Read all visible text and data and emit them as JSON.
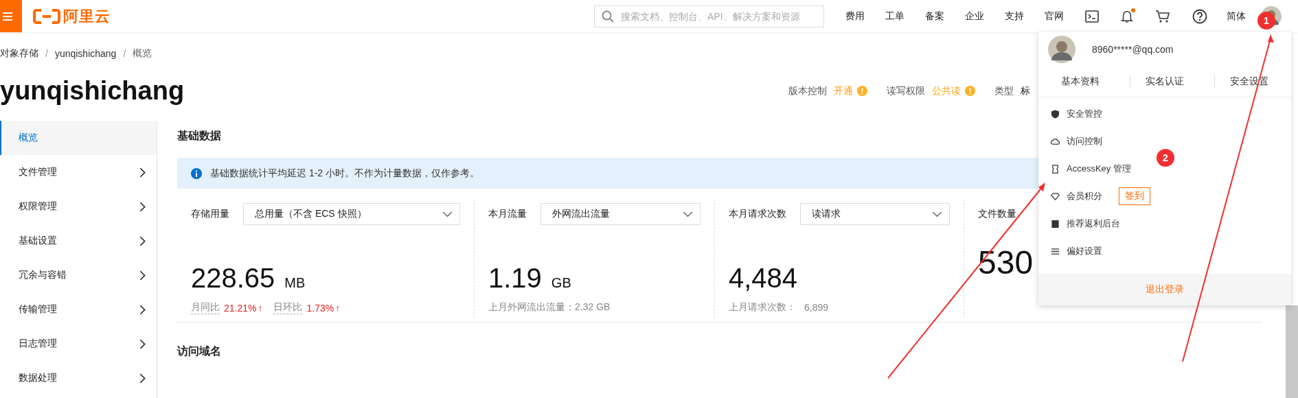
{
  "topbar": {
    "logo": "阿里云",
    "search": {
      "placeholder": "搜索文档、控制台、API、解决方案和资源"
    },
    "nav": [
      "费用",
      "工单",
      "备案",
      "企业",
      "支持",
      "官网"
    ],
    "bell_unread": true,
    "language": "简体"
  },
  "breadcrumb": {
    "separator": "/",
    "items": [
      "对象存储",
      "yunqishichang",
      "概览"
    ]
  },
  "bucket": {
    "title": "yunqishichang",
    "meta": [
      {
        "label": "版本控制",
        "value": "开通",
        "warning": true
      },
      {
        "label": "读写权限",
        "value": "公共读",
        "warning": true
      },
      {
        "label": "类型",
        "value": "标"
      }
    ]
  },
  "sidebar": {
    "items": [
      {
        "label": "概览",
        "selected": true,
        "expandable": false
      },
      {
        "label": "文件管理",
        "selected": false,
        "expandable": true
      },
      {
        "label": "权限管理",
        "selected": false,
        "expandable": true
      },
      {
        "label": "基础设置",
        "selected": false,
        "expandable": true
      },
      {
        "label": "冗余与容错",
        "selected": false,
        "expandable": true
      },
      {
        "label": "传输管理",
        "selected": false,
        "expandable": true
      },
      {
        "label": "日志管理",
        "selected": false,
        "expandable": true
      },
      {
        "label": "数据处理",
        "selected": false,
        "expandable": true
      }
    ]
  },
  "overview": {
    "title": "基础数据",
    "notice": "基础数据统计平均延迟 1-2 小时。不作为计量数据，仅作参考。",
    "stats": [
      {
        "label": "存储用量",
        "select": "总用量（不含 ECS 快照）",
        "value": "228.65",
        "unit": "MB",
        "compare": [
          {
            "label": "月同比",
            "value": "21.21%",
            "arrow": "↑"
          },
          {
            "label": "日环比",
            "value": "1.73%",
            "arrow": "↑"
          }
        ]
      },
      {
        "label": "本月流量",
        "select": "外网流出流量",
        "value": "1.19",
        "unit": "GB",
        "footnote": "上月外网流出流量：2.32 GB"
      },
      {
        "label": "本月请求次数",
        "select": "读请求",
        "value": "4,484",
        "footnote": "上月请求次数：",
        "footnote_value": "6,899"
      },
      {
        "label": "文件数量",
        "value": "530"
      }
    ]
  },
  "domains": {
    "title": "访问域名"
  },
  "account_menu": {
    "email": "8960*****@qq.com",
    "links": [
      "基本资料",
      "实名认证",
      "安全设置"
    ],
    "items": [
      {
        "kind": "plain",
        "label": "安全管控"
      },
      {
        "kind": "plain",
        "label": "访问控制"
      },
      {
        "kind": "plain",
        "label": "AccessKey 管理"
      },
      {
        "kind": "action",
        "label": "会员积分",
        "action": "签到"
      },
      {
        "kind": "plain",
        "label": "推荐返利后台"
      },
      {
        "kind": "plain",
        "label": "偏好设置"
      }
    ],
    "logout": "退出登录"
  },
  "annotations": [
    {
      "label": "1"
    },
    {
      "label": "2"
    }
  ]
}
